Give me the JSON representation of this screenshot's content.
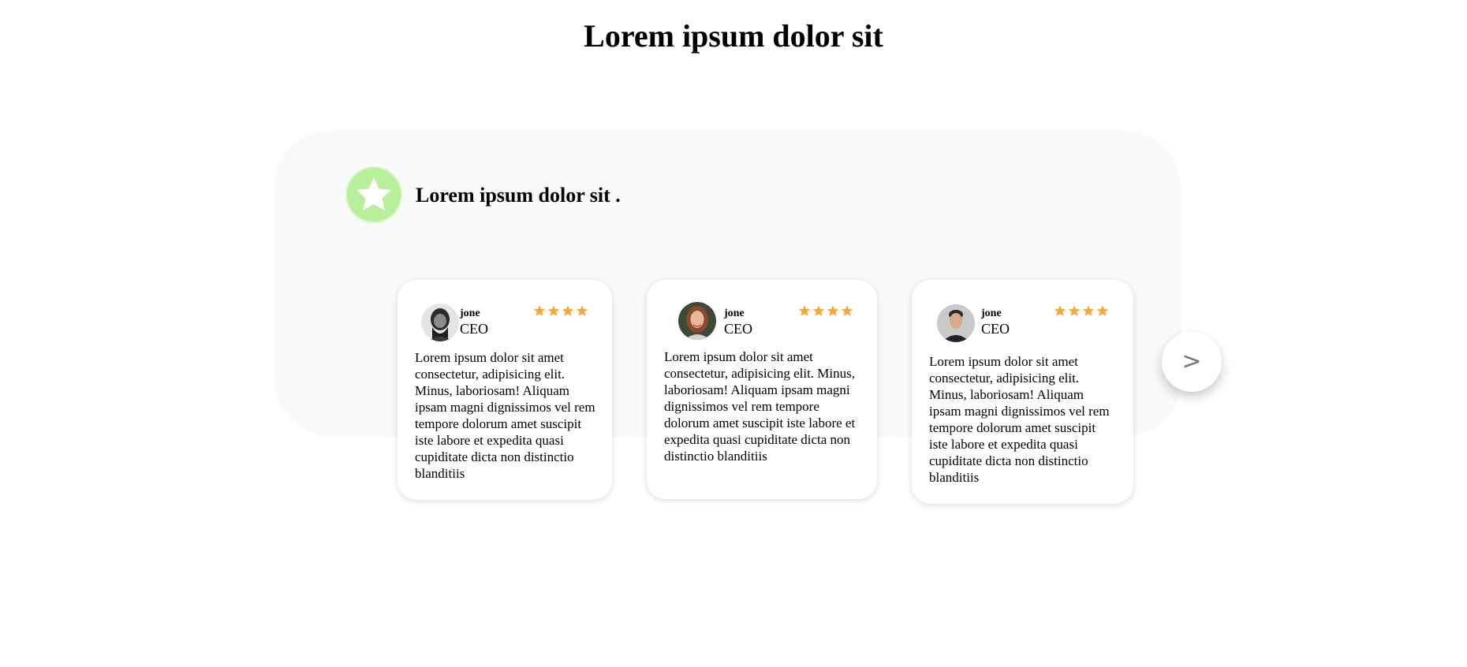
{
  "page": {
    "title": "Lorem ipsum dolor sit"
  },
  "section": {
    "icon": "star-badge-icon",
    "title": "Lorem ipsum dolor sit ."
  },
  "colors": {
    "accent_green": "#b7ef9c",
    "star_orange": "#f4a93c",
    "panel_background": "#f8f9fa"
  },
  "testimonials": [
    {
      "name": "jone",
      "role": "CEO",
      "rating": 4,
      "text": "Lorem ipsum dolor sit amet consectetur, adipisicing elit. Minus, laboriosam! Aliquam ipsam magni dignissimos vel rem tempore dolorum amet suscipit iste labore et expedita quasi cupiditate dicta non distinctio blanditiis"
    },
    {
      "name": "jone",
      "role": "CEO",
      "rating": 4,
      "text": "Lorem ipsum dolor sit amet consectetur, adipisicing elit. Minus, laboriosam! Aliquam ipsam magni dignissimos vel rem tempore dolorum amet suscipit iste labore et expedita quasi cupiditate dicta non distinctio blanditiis"
    },
    {
      "name": "jone",
      "role": "CEO",
      "rating": 4,
      "text": "Lorem ipsum dolor sit amet consectetur, adipisicing elit. Minus, laboriosam! Aliquam ipsam magni dignissimos vel rem tempore dolorum amet suscipit iste labore et expedita quasi cupiditate dicta non distinctio blanditiis"
    }
  ],
  "carousel": {
    "next_label": ">"
  }
}
